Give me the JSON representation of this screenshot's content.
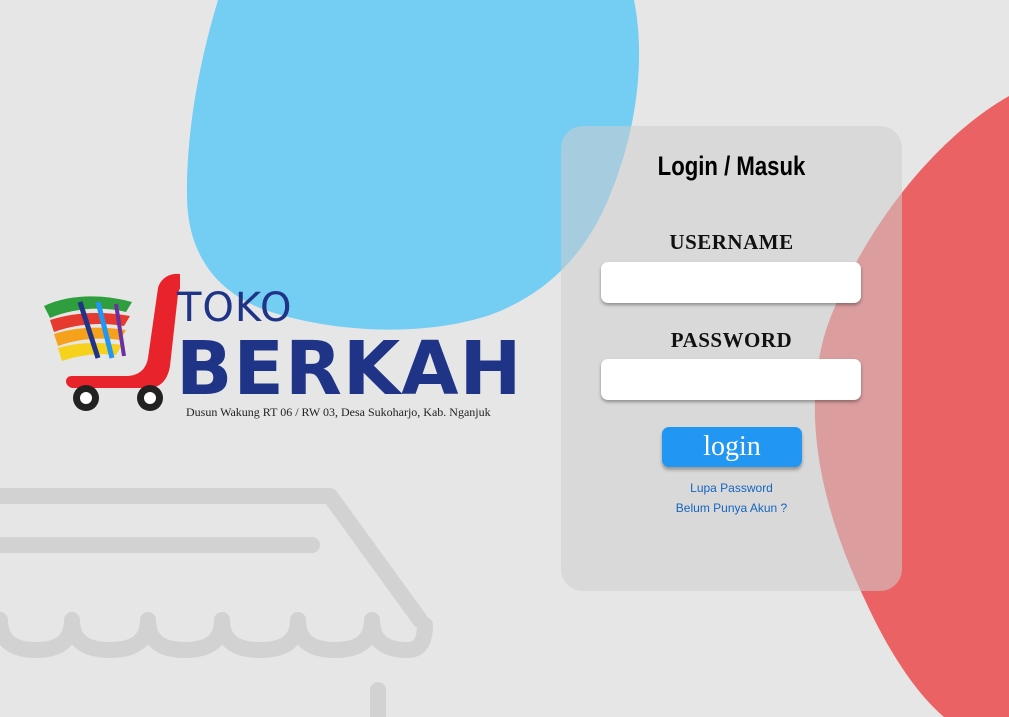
{
  "colors": {
    "background": "#e6e6e6",
    "blue_blob": "#74cdf3",
    "red_blob": "#ec4448",
    "brand_navy": "#1f3487",
    "button_blue": "#2196f3",
    "link_blue": "#1565c0"
  },
  "logo": {
    "line1": "TOKO",
    "line2": "BERKAH",
    "address": "Dusun Wakung RT 06 / RW 03, Desa Sukoharjo, Kab. Nganjuk",
    "icon": "shopping-cart-icon"
  },
  "login": {
    "title": "Login / Masuk",
    "username_label": "USERNAME",
    "username_value": "",
    "password_label": "PASSWORD",
    "password_value": "",
    "button_label": "login",
    "forgot_password": "Lupa Password",
    "register": "Belum Punya Akun ?"
  }
}
